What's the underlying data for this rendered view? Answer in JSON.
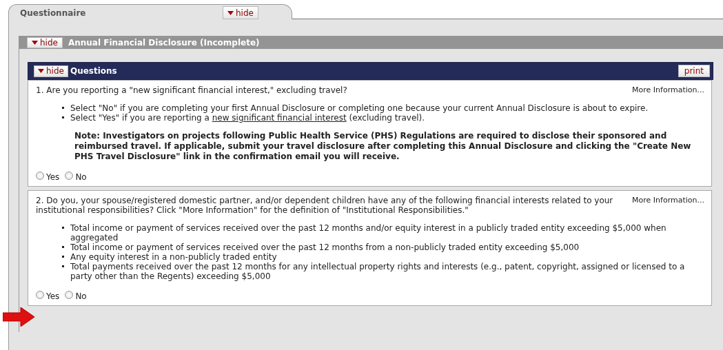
{
  "tab": {
    "title": "Questionnaire",
    "toggle": "hide"
  },
  "section": {
    "toggle": "hide",
    "title": "Annual Financial Disclosure (Incomplete)"
  },
  "questions_panel": {
    "toggle": "hide",
    "title": "Questions",
    "print": "print"
  },
  "questions": [
    {
      "text": "1. Are you reporting a \"new significant financial interest,\" excluding travel?",
      "more": "More Information...",
      "bullets": [
        [
          {
            "text": "Select \"No\" if you are completing your first Annual Disclosure or completing one because your current Annual Disclosure is about to expire."
          }
        ],
        [
          {
            "text": "Select \"Yes\" if you are reporting a "
          },
          {
            "text": "new significant financial interest",
            "kind": "link"
          },
          {
            "text": " (excluding travel)."
          }
        ]
      ],
      "note": "Note: Investigators on projects following Public Health Service (PHS) Regulations are required to disclose their sponsored and reimbursed travel. If applicable, submit your travel disclosure after completing this Annual Disclosure and clicking the \"Create New PHS Travel Disclosure\" link in the confirmation email you will receive.",
      "options": [
        {
          "label": "Yes",
          "selected": false
        },
        {
          "label": "No",
          "selected": false
        }
      ]
    },
    {
      "text": "2. Do you, your spouse/registered domestic partner, and/or dependent children have any of the following financial interests related to your institutional responsibilities? Click \"More Information\" for the definition of \"Institutional Responsibilities.\"",
      "more": "More Information...",
      "bullets": [
        [
          {
            "text": "Total income or payment of services received over the past 12 months and/or equity interest in a publicly traded entity exceeding $5,000 when aggregated"
          }
        ],
        [
          {
            "text": "Total income or payment of services received over the past 12 months from a non-publicly traded entity exceeding $5,000"
          }
        ],
        [
          {
            "text": "Any equity interest in a non-publicly traded entity"
          }
        ],
        [
          {
            "text": "Total payments received over the past 12 months for any intellectual property rights and interests (e.g., patent, copyright, assigned or licensed to a party other than the Regents) exceeding $5,000"
          }
        ]
      ],
      "options": [
        {
          "label": "Yes",
          "selected": false
        },
        {
          "label": "No",
          "selected": false
        }
      ]
    }
  ]
}
